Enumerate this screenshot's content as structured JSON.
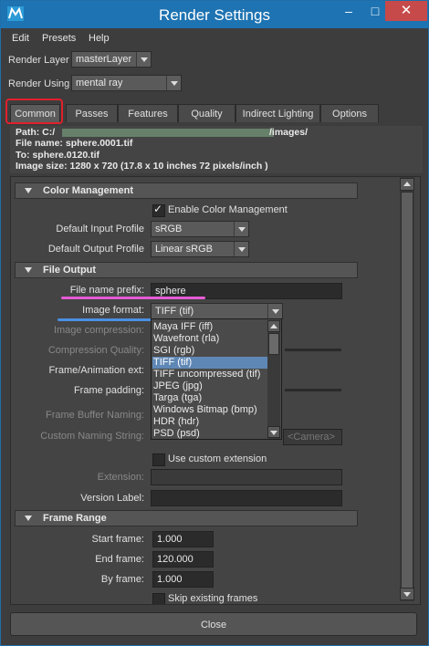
{
  "window": {
    "title": "Render Settings"
  },
  "menu": [
    "Edit",
    "Presets",
    "Help"
  ],
  "render_layer": {
    "label": "Render Layer",
    "value": "masterLayer"
  },
  "render_using": {
    "label": "Render Using",
    "value": "mental ray"
  },
  "tabs": [
    "Common",
    "Passes",
    "Features",
    "Quality",
    "Indirect Lighting",
    "Options"
  ],
  "active_tab": "Common",
  "info": {
    "path_label": "Path: C:/",
    "path_suffix": "/images/",
    "file_name": "File name:  sphere.0001.tif",
    "to": "To:           sphere.0120.tif",
    "image_size": "Image size: 1280 x 720 (17.8 x 10 inches 72 pixels/inch )"
  },
  "color_management": {
    "header": "Color Management",
    "enable_label": "Enable Color Management",
    "enable_checked": true,
    "input_profile_label": "Default Input Profile",
    "input_profile_value": "sRGB",
    "output_profile_label": "Default Output Profile",
    "output_profile_value": "Linear sRGB"
  },
  "file_output": {
    "header": "File Output",
    "prefix_label": "File name prefix:",
    "prefix_value": "sphere",
    "format_label": "Image format:",
    "format_value": "TIFF (tif)",
    "compression_label": "Image compression:",
    "quality_label": "Compression Quality:",
    "frame_ext_label": "Frame/Animation ext:",
    "padding_label": "Frame padding:",
    "buffer_label": "Frame Buffer Naming:",
    "custom_naming_label": "Custom Naming String:",
    "custom_naming_value": "<Camera>",
    "use_custom_ext_label": "Use custom extension",
    "use_custom_ext_checked": false,
    "extension_label": "Extension:",
    "version_label": "Version Label:"
  },
  "format_options": [
    "Maya IFF (iff)",
    "Wavefront (rla)",
    "SGI (rgb)",
    "TIFF (tif)",
    "TIFF uncompressed (tif)",
    "JPEG (jpg)",
    "Targa (tga)",
    "Windows Bitmap (bmp)",
    "HDR (hdr)",
    "PSD (psd)"
  ],
  "selected_format_index": 3,
  "frame_range": {
    "header": "Frame Range",
    "start_label": "Start frame:",
    "start_value": "1.000",
    "end_label": "End frame:",
    "end_value": "120.000",
    "by_label": "By frame:",
    "by_value": "1.000",
    "skip_label": "Skip existing frames",
    "skip_checked": false
  },
  "close_label": "Close",
  "colors": {
    "title_bar": "#1e73b2",
    "close_window": "#c74a4a",
    "highlight_red": "#e0202b",
    "pink_underline": "#e55bd4",
    "blue_underline": "#4a90e2",
    "selected_option": "#5f87b5"
  }
}
